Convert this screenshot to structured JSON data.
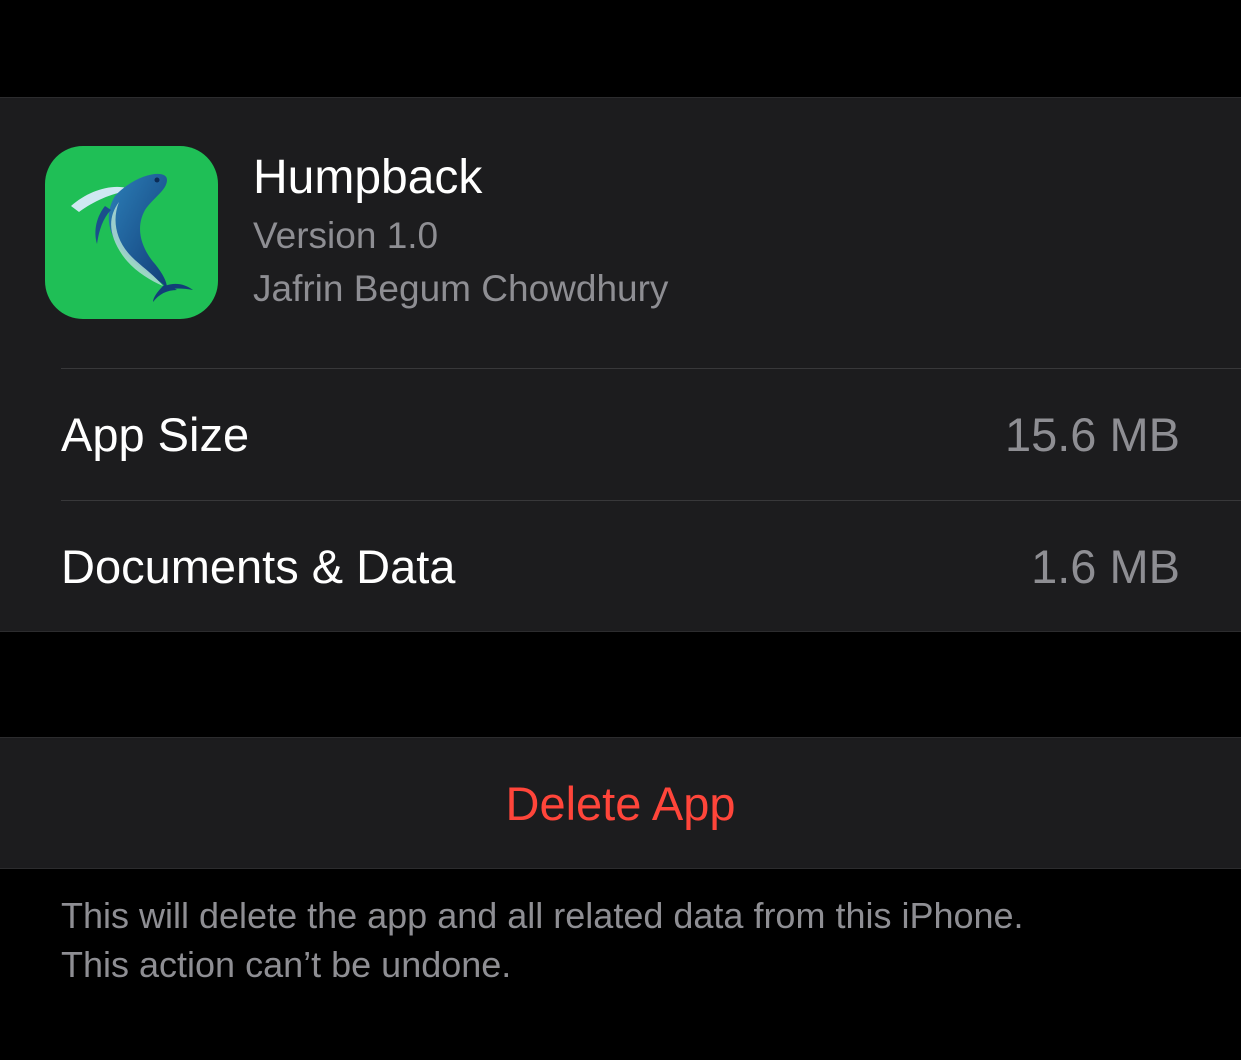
{
  "app": {
    "name": "Humpback",
    "version": "Version 1.0",
    "developer": "Jafrin Begum Chowdhury",
    "icon": "humpback-whale-icon",
    "icon_background": "#1fbf56"
  },
  "storage": {
    "rows": [
      {
        "label": "App Size",
        "value": "15.6 MB"
      },
      {
        "label": "Documents & Data",
        "value": "1.6 MB"
      }
    ]
  },
  "actions": {
    "delete_label": "Delete App",
    "delete_color": "#ff453a"
  },
  "footer": {
    "line1": "This will delete the app and all related data from this iPhone.",
    "line2": "This action can’t be undone."
  }
}
